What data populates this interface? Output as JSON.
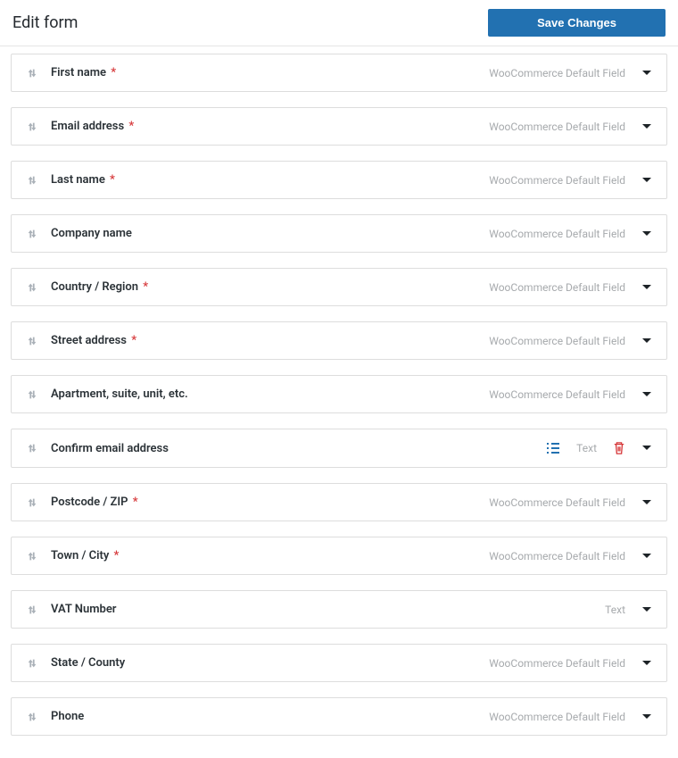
{
  "header": {
    "title": "Edit form",
    "save_label": "Save Changes"
  },
  "fields": [
    {
      "label": "First name",
      "required": true,
      "type": "WooCommerce Default Field",
      "custom": false
    },
    {
      "label": "Email address",
      "required": true,
      "type": "WooCommerce Default Field",
      "custom": false
    },
    {
      "label": "Last name",
      "required": true,
      "type": "WooCommerce Default Field",
      "custom": false
    },
    {
      "label": "Company name",
      "required": false,
      "type": "WooCommerce Default Field",
      "custom": false
    },
    {
      "label": "Country / Region",
      "required": true,
      "type": "WooCommerce Default Field",
      "custom": false
    },
    {
      "label": "Street address",
      "required": true,
      "type": "WooCommerce Default Field",
      "custom": false
    },
    {
      "label": "Apartment, suite, unit, etc.",
      "required": false,
      "type": "WooCommerce Default Field",
      "custom": false
    },
    {
      "label": "Confirm email address",
      "required": false,
      "type": "Text",
      "custom": true
    },
    {
      "label": "Postcode / ZIP",
      "required": true,
      "type": "WooCommerce Default Field",
      "custom": false
    },
    {
      "label": "Town / City",
      "required": true,
      "type": "WooCommerce Default Field",
      "custom": false
    },
    {
      "label": "VAT Number",
      "required": false,
      "type": "Text",
      "custom": false
    },
    {
      "label": "State / County",
      "required": false,
      "type": "WooCommerce Default Field",
      "custom": false
    },
    {
      "label": "Phone",
      "required": false,
      "type": "WooCommerce Default Field",
      "custom": false
    }
  ]
}
